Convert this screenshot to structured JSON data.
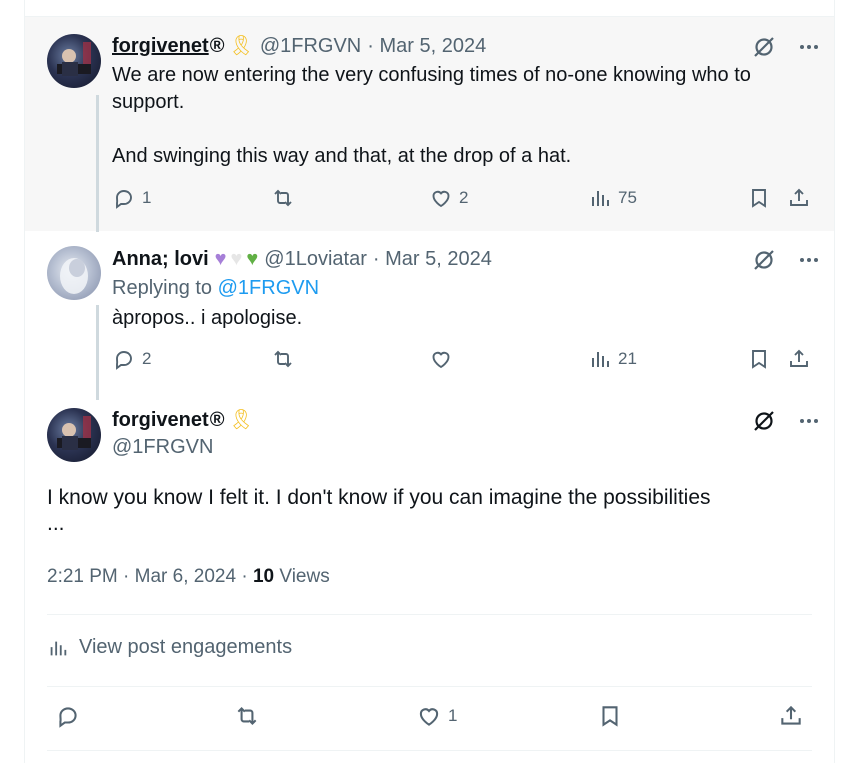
{
  "tweets": [
    {
      "name": "forgivenet",
      "badge": "®",
      "handle": "@1FRGVN",
      "date": "· Mar 5, 2024",
      "text_lines": [
        "We are now entering the very confusing times of no-one knowing who to",
        "support."
      ],
      "text_line3": "And swinging this way and that, at the drop of a hat.",
      "replies": "1",
      "reposts": "",
      "likes": "2",
      "views": "75"
    },
    {
      "name": "Anna; lovi",
      "handle": "@1Loviatar",
      "date": "· Mar 5, 2024",
      "replying_prefix": "Replying to",
      "replying_to": "@1FRGVN",
      "text": "àpropos.. i apologise.",
      "replies": "2",
      "reposts": "",
      "likes": "",
      "views": "21"
    }
  ],
  "main_tweet": {
    "name": "forgivenet",
    "badge": "®",
    "handle": "@1FRGVN",
    "text_line1": "I know you know I felt it. I don't know if you can imagine the possibilities",
    "text_line2": "...",
    "time": "2:21 PM · Mar 6, 2024 ·",
    "views_count": "10",
    "views_label": "Views",
    "engagements_label": "View post engagements",
    "likes": "1"
  },
  "colors": {
    "accent": "#1d9bf0",
    "muted": "#536471",
    "text": "#0f1419"
  },
  "icons": [
    "grok-icon",
    "more-icon",
    "reply-icon",
    "repost-icon",
    "like-icon",
    "views-icon",
    "bookmark-icon",
    "share-icon",
    "ribbon-icon"
  ]
}
